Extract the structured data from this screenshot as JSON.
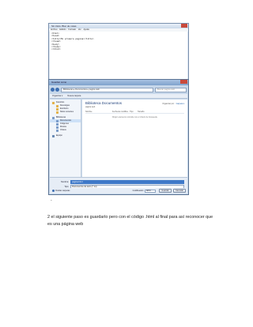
{
  "notepad": {
    "title": "Sin título: Bloc de notas",
    "menu": [
      "Archivo",
      "Edición",
      "Formato",
      "Ver",
      "Ayuda"
    ],
    "lines": [
      "<html>",
      "<head>",
      "<title>Mi primera pagina</title>",
      "</head>",
      "<body>",
      "",
      "",
      "",
      "</body>",
      "</html>"
    ]
  },
  "dialog": {
    "title": "Guardar como",
    "path": "Bibliotecas ▸ Documentos ▸ pagina web",
    "search_placeholder": "Buscar pagina web",
    "toolbar": [
      "Organizar ▾",
      "Nueva carpeta"
    ],
    "nav": [
      {
        "label": "Favoritos",
        "type": "fav",
        "sub": false
      },
      {
        "label": "Descargas",
        "type": "fav",
        "sub": true
      },
      {
        "label": "Escritorio",
        "type": "fav",
        "sub": true
      },
      {
        "label": "Sitios recientes",
        "type": "fav",
        "sub": true
      },
      {
        "label": "Bibliotecas",
        "type": "lib",
        "sub": false
      },
      {
        "label": "Documentos",
        "type": "lib",
        "sub": true,
        "selected": true
      },
      {
        "label": "Imágenes",
        "type": "lib",
        "sub": true
      },
      {
        "label": "Música",
        "type": "lib",
        "sub": true
      },
      {
        "label": "Vídeos",
        "type": "lib",
        "sub": true
      },
      {
        "label": "Equipo",
        "type": "pc",
        "sub": false
      }
    ],
    "library_title": "Biblioteca Documentos",
    "library_subtitle": "pagina web",
    "arrange_label": "Organizar por:",
    "arrange_value": "Carpeta ▾",
    "columns": [
      "Nombre",
      "Fecha de modifica...",
      "Tipo",
      "Tamaño"
    ],
    "empty_message": "Ningún elemento coincide con el criterio de búsqueda.",
    "filename_label": "Nombre:",
    "filename_value": "pagina.html",
    "type_label": "Tipo:",
    "type_value": "Documentos de texto (*.txt)",
    "hide_folders": "Ocultar carpetas",
    "encoding_label": "Codificación:",
    "encoding_value": "ANSI",
    "save_button": "Guardar",
    "cancel_button": "Cancelar"
  },
  "caret": "-",
  "paragraph": "2 el siguiente paso es guardarlo pero con el código .html al final para así reconocer que es una página web"
}
